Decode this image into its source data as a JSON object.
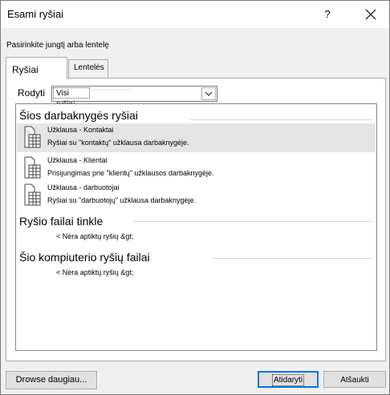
{
  "window": {
    "title": "Esami ryšiai",
    "help": "?"
  },
  "instruction": "Pasirinkite jungtį arba lentelę",
  "tabs": {
    "connections": "Ryšiai",
    "tables": "Lentelės"
  },
  "show": {
    "label": "Rodyti",
    "value": "Visi ryšiai"
  },
  "sections": {
    "workbook": {
      "header": "Šios darbaknygės ryšiai",
      "items": [
        {
          "name": "Užklausa - Kontaktai",
          "description": "Ryšiai su \"kontaktų\" užklausa darbaknygėje.",
          "selected": true
        },
        {
          "name": "Užklausa - Klientai",
          "description": "Prisijungimas prie \"klientų\" užklausos darbaknygėje.",
          "selected": false
        },
        {
          "name": "Užklausa - darbuotojai",
          "description": "Ryšiai su \"darbuotojų\" užklausa darbaknygėje.",
          "selected": false
        }
      ]
    },
    "network": {
      "header": "Ryšio failai tinkle",
      "empty": "< Nėra aptiktų ryšių &gt;"
    },
    "computer": {
      "header": "Šio kompiuterio ryšių failai",
      "empty": "< Nėra aptiktų ryšių &gt;"
    }
  },
  "buttons": {
    "browse": "Drowse daugiau...",
    "open": "Atidaryti",
    "cancel": "Atšaukti"
  },
  "icons": {
    "help": "help-icon",
    "close": "close-icon",
    "dropdown": "chevron-down-icon",
    "item": "table-document-icon"
  },
  "colors": {
    "selection": "#e5e5e5",
    "focus_border": "#0078d7"
  }
}
